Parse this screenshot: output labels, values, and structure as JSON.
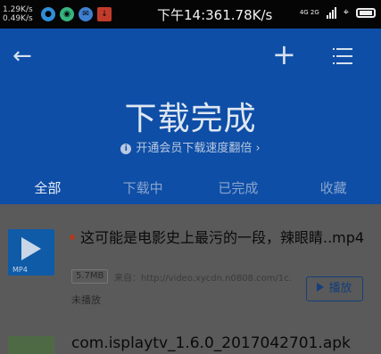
{
  "status_bar": {
    "upload_speed": "1.29K/s",
    "download_speed": "0.49K/s",
    "time_and_speed": "下午14:361.78K/s",
    "network": "4G 2G"
  },
  "header": {
    "title": "下载完成",
    "vip_promo": "开通会员下载速度翻倍",
    "tabs": [
      "全部",
      "下载中",
      "已完成",
      "收藏"
    ]
  },
  "downloads": [
    {
      "name": "这可能是电影史上最污的一段，辣眼睛..mp4",
      "format": "MP4",
      "size": "5.7MB",
      "source": "来自：http://video.xycdn.n0808.com/1c...",
      "status": "未播放",
      "action": "播放"
    },
    {
      "name": "com.isplaytv_1.6.0_2017042701.apk"
    }
  ],
  "colors": {
    "header_bg": "#0e4ea6",
    "content_bg": "#5a5a5a"
  }
}
